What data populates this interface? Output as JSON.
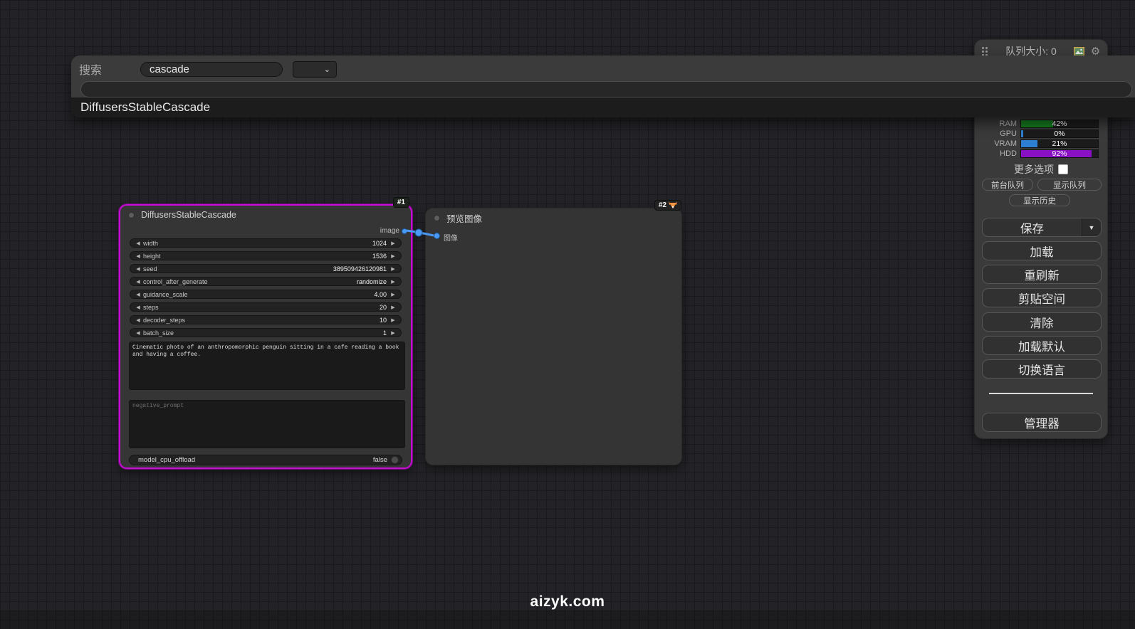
{
  "icons": {
    "left_arrow": "◀",
    "right_arrow": "▶",
    "dropdown_arrow": "▼",
    "select_chevron": "⌄",
    "gear": "⚙"
  },
  "top_bar": {
    "queue_size_text": "队列大小: 0"
  },
  "search_dialog": {
    "label": "搜索",
    "query": "cascade",
    "result": "DiffusersStableCascade"
  },
  "sidebar": {
    "meters": [
      {
        "label": "RAM",
        "percent": "42%",
        "fill_width": "42%",
        "fill_color": "#157a1e"
      },
      {
        "label": "GPU",
        "percent": "0%",
        "fill_width": "3%",
        "fill_color": "#2d7fd4"
      },
      {
        "label": "VRAM",
        "percent": "21%",
        "fill_width": "21%",
        "fill_color": "#2d7fd4"
      },
      {
        "label": "HDD",
        "percent": "92%",
        "fill_width": "92%",
        "fill_color": "#8a10c4"
      }
    ],
    "more_options_label": "更多选项",
    "front_queue_label": "前台队列",
    "show_queue_label": "显示队列",
    "show_history_label": "显示历史",
    "save_label": "保存",
    "load_label": "加载",
    "refresh_label": "重刷新",
    "clipspace_label": "剪贴空间",
    "clear_label": "清除",
    "load_default_label": "加载默认",
    "switch_language_label": "切换语言",
    "manager_label": "管理器"
  },
  "node1": {
    "badge": "#1",
    "title": "DiffusersStableCascade",
    "output_label": "image",
    "widgets": [
      {
        "label": "width",
        "value": "1024"
      },
      {
        "label": "height",
        "value": "1536"
      },
      {
        "label": "seed",
        "value": "389509426120981"
      },
      {
        "label": "control_after_generate",
        "value": "randomize"
      },
      {
        "label": "guidance_scale",
        "value": "4.00"
      },
      {
        "label": "steps",
        "value": "20"
      },
      {
        "label": "decoder_steps",
        "value": "10"
      },
      {
        "label": "batch_size",
        "value": "1"
      }
    ],
    "prompt": "Cinematic photo of an anthropomorphic penguin sitting in a cafe reading a book and having a coffee.",
    "negative_prompt_placeholder": "negative_prompt",
    "toggle_label": "model_cpu_offload",
    "toggle_value": "false"
  },
  "node2": {
    "badge": "#2",
    "title": "预览图像",
    "input_label": "图像"
  },
  "watermark": "aizyk.com",
  "colors": {
    "selected_node_border": "#c50ed2",
    "link": "#4a9af5"
  }
}
